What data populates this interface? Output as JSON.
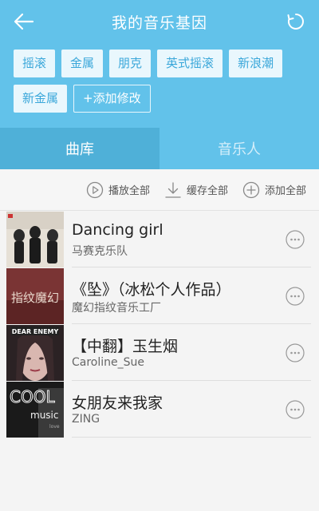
{
  "header": {
    "title": "我的音乐基因",
    "back_icon": "back-arrow-icon",
    "refresh_icon": "refresh-icon",
    "bg_color": "#62c2ea"
  },
  "tags": [
    "摇滚",
    "金属",
    "朋克",
    "英式摇滚",
    "新浪潮",
    "新金属"
  ],
  "add_tag_label": "+添加修改",
  "tabs": [
    {
      "label": "曲库",
      "active": true
    },
    {
      "label": "音乐人",
      "active": false
    }
  ],
  "actions": {
    "play_all": "播放全部",
    "cache_all": "缓存全部",
    "add_all": "添加全部"
  },
  "songs": [
    {
      "title": "Dancing girl",
      "artist": "马赛克乐队"
    },
    {
      "title": "《坠》（冰松个人作品）",
      "artist": "魔幻指纹音乐工厂"
    },
    {
      "title": "【中翻】玉生烟",
      "artist": "Caroline_Sue"
    },
    {
      "title": "女朋友来我家",
      "artist": "ZING"
    }
  ],
  "covers": {
    "cover2_text": "指纹魔幻",
    "cover3_text": "DEAR ENEMY",
    "cover4_text1": "COOL",
    "cover4_text2": "music",
    "cover4_text3": "love"
  }
}
